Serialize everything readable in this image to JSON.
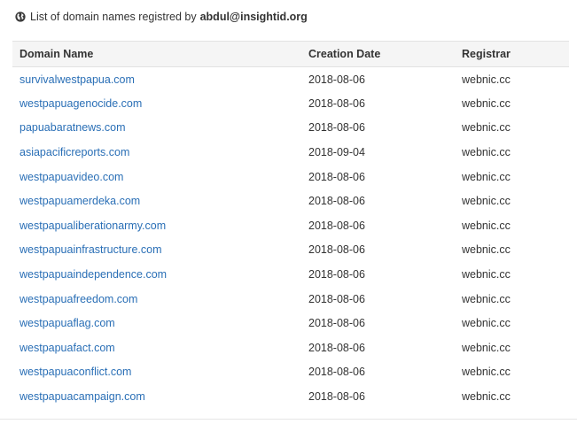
{
  "heading": {
    "icon": "globe-icon",
    "prefix": "List of domain names registred by",
    "email": "abdul@insightid.org"
  },
  "table": {
    "columns": [
      "Domain Name",
      "Creation Date",
      "Registrar"
    ],
    "rows": [
      {
        "domain": "survivalwestpapua.com",
        "date": "2018-08-06",
        "registrar": "webnic.cc"
      },
      {
        "domain": "westpapuagenocide.com",
        "date": "2018-08-06",
        "registrar": "webnic.cc"
      },
      {
        "domain": "papuabaratnews.com",
        "date": "2018-08-06",
        "registrar": "webnic.cc"
      },
      {
        "domain": "asiapacificreports.com",
        "date": "2018-09-04",
        "registrar": "webnic.cc"
      },
      {
        "domain": "westpapuavideo.com",
        "date": "2018-08-06",
        "registrar": "webnic.cc"
      },
      {
        "domain": "westpapuamerdeka.com",
        "date": "2018-08-06",
        "registrar": "webnic.cc"
      },
      {
        "domain": "westpapualiberationarmy.com",
        "date": "2018-08-06",
        "registrar": "webnic.cc"
      },
      {
        "domain": "westpapuainfrastructure.com",
        "date": "2018-08-06",
        "registrar": "webnic.cc"
      },
      {
        "domain": "westpapuaindependence.com",
        "date": "2018-08-06",
        "registrar": "webnic.cc"
      },
      {
        "domain": "westpapuafreedom.com",
        "date": "2018-08-06",
        "registrar": "webnic.cc"
      },
      {
        "domain": "westpapuaflag.com",
        "date": "2018-08-06",
        "registrar": "webnic.cc"
      },
      {
        "domain": "westpapuafact.com",
        "date": "2018-08-06",
        "registrar": "webnic.cc"
      },
      {
        "domain": "westpapuaconflict.com",
        "date": "2018-08-06",
        "registrar": "webnic.cc"
      },
      {
        "domain": "westpapuacampaign.com",
        "date": "2018-08-06",
        "registrar": "webnic.cc"
      }
    ]
  },
  "colors": {
    "link": "#2a6fb6",
    "header_bg": "#f5f5f5",
    "text": "#333333"
  }
}
